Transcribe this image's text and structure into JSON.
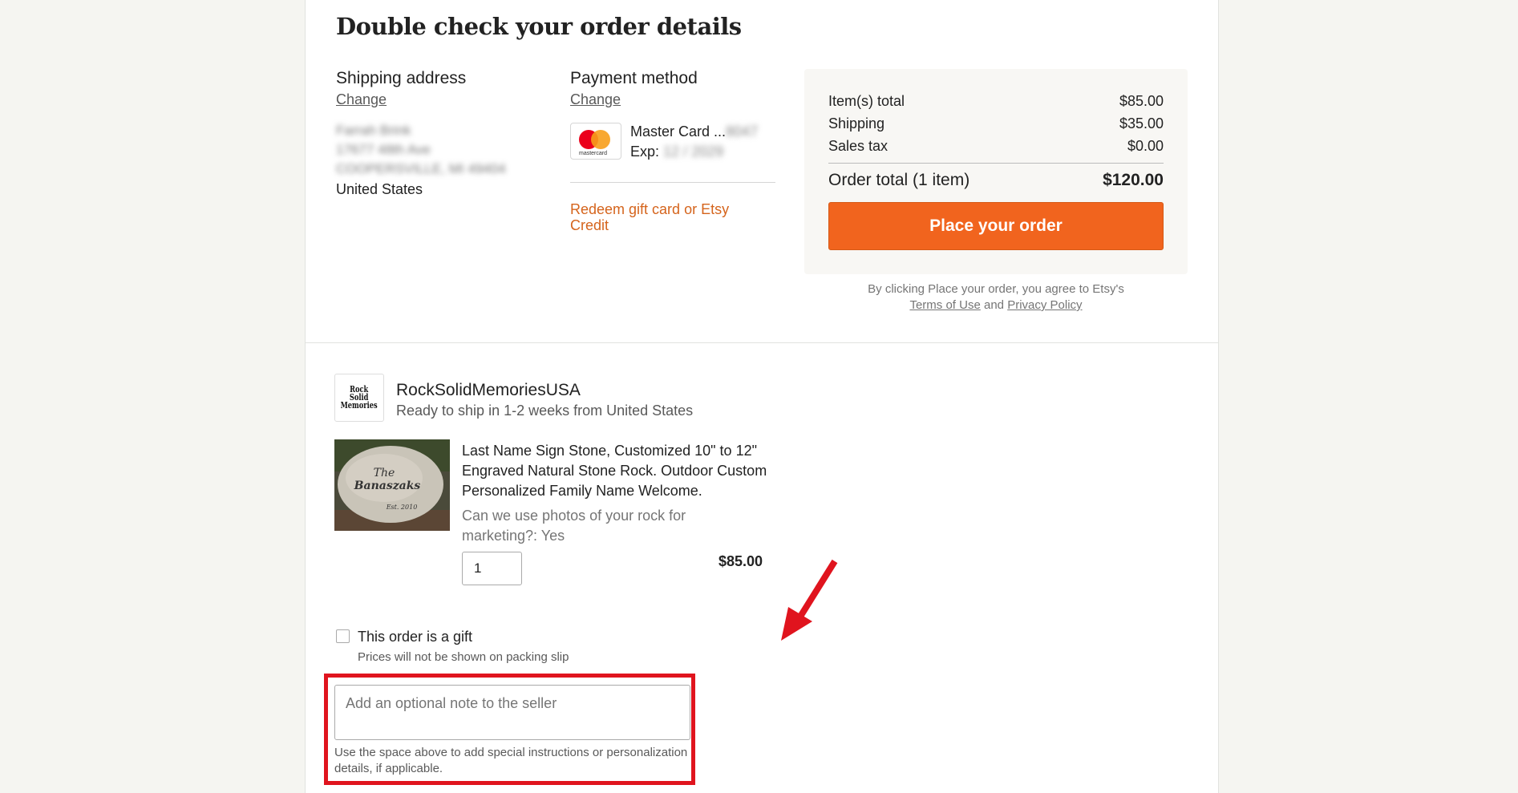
{
  "page": {
    "title": "Double check your order details"
  },
  "shipping": {
    "heading": "Shipping address",
    "change_label": "Change",
    "name_blurred": "Farrah Brink",
    "street_blurred": "17677 48th Ave",
    "city_blurred": "COOPERSVILLE, MI 49404",
    "country": "United States"
  },
  "payment": {
    "heading": "Payment method",
    "change_label": "Change",
    "card_brand_logo_text": "mastercard",
    "card_label": "Master Card ...",
    "card_digits_blurred": "8047",
    "exp_label": "Exp:",
    "exp_value_blurred": "12 / 2029",
    "gift_card_link": "Redeem gift card or Etsy Credit"
  },
  "summary": {
    "items_total_label": "Item(s) total",
    "items_total_value": "$85.00",
    "shipping_label": "Shipping",
    "shipping_value": "$35.00",
    "tax_label": "Sales tax",
    "tax_value": "$0.00",
    "order_total_label": "Order total (1 item)",
    "order_total_value": "$120.00",
    "place_order_label": "Place your order",
    "accent_color": "#f1641e"
  },
  "terms": {
    "prefix": "By clicking Place your order, you agree to Etsy's",
    "terms_link": "Terms of Use",
    "and": "and",
    "privacy_link": "Privacy Policy"
  },
  "shop": {
    "logo_text_line1": "Rock Solid",
    "logo_text_line2": "Memories",
    "name": "RockSolidMemoriesUSA",
    "ship_info": "Ready to ship in 1-2 weeks from United States"
  },
  "product": {
    "image_text_line1": "The",
    "image_text_line2": "Banaszaks",
    "image_text_line3": "Est. 2010",
    "title": "Last Name Sign Stone, Customized 10\" to 12\" Engraved Natural Stone Rock. Outdoor Custom Personalized Family Name Welcome.",
    "option": "Can we use photos of your rock for marketing?: Yes",
    "quantity": "1",
    "price": "$85.00"
  },
  "gift": {
    "label": "This order is a gift",
    "sublabel": "Prices will not be shown on packing slip",
    "checked": false
  },
  "note": {
    "placeholder": "Add an optional note to the seller",
    "help": "Use the space above to add special instructions or personalization details, if applicable."
  },
  "annotation": {
    "highlight_color": "#e0141e"
  }
}
